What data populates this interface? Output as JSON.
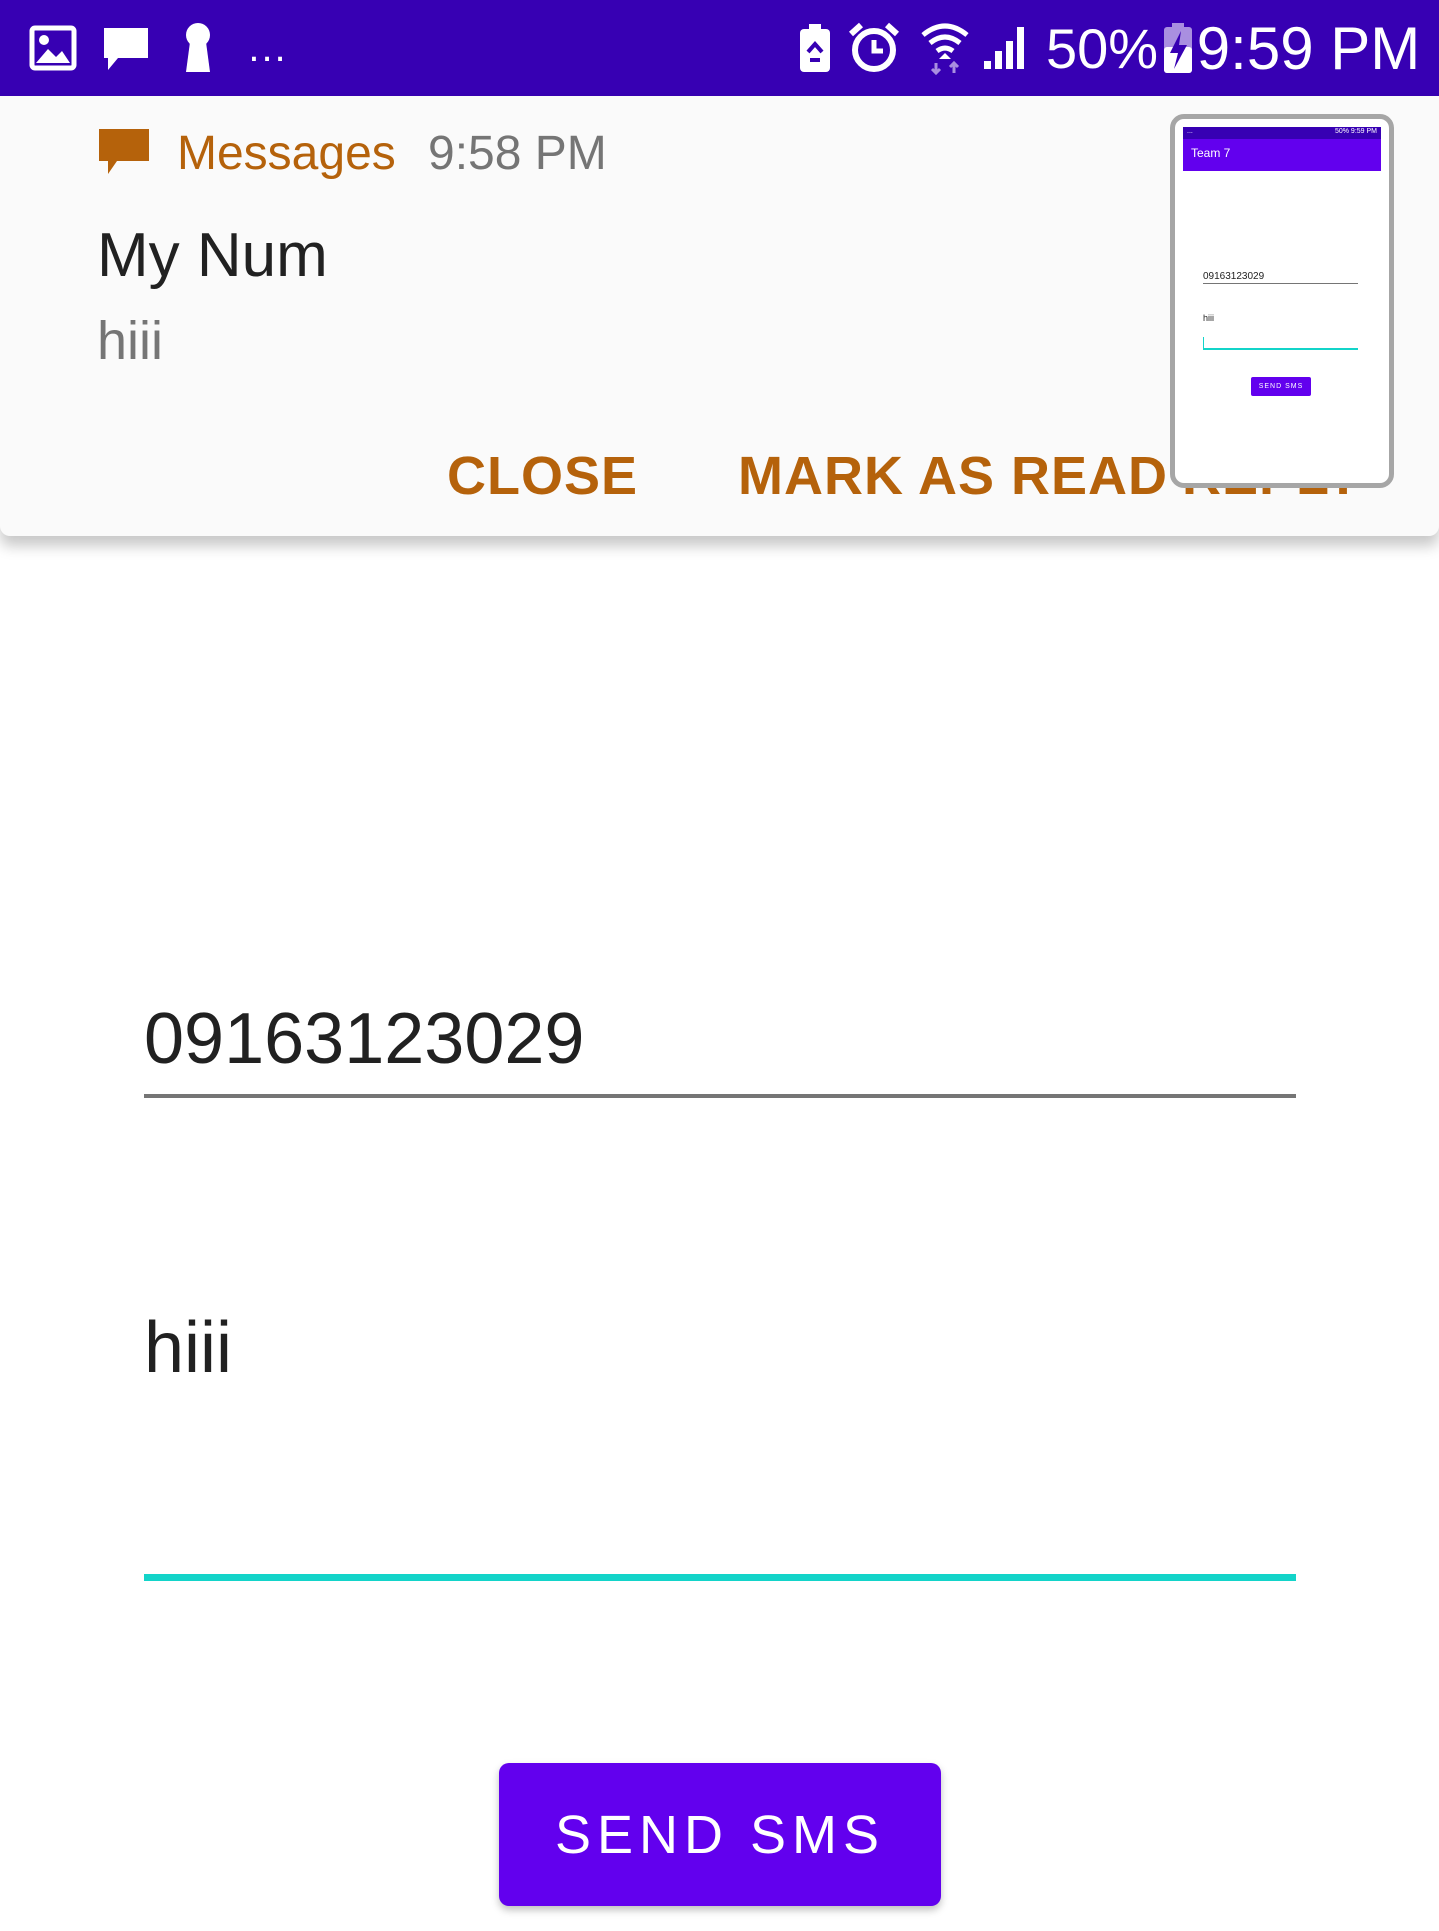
{
  "status_bar": {
    "left_icons": [
      "image-icon",
      "chat-bubble-icon",
      "keyhole-icon"
    ],
    "overflow": "...",
    "right_icons": [
      "battery-saver-icon",
      "alarm-clock-icon",
      "wifi-icon",
      "cell-signal-icon",
      "charging-battery-icon"
    ],
    "battery_percent": "50%",
    "time": "9:59 PM",
    "background": "#3700b3"
  },
  "notification": {
    "app_icon": "message-bubble-icon",
    "app_name": "Messages",
    "time": "9:58 PM",
    "title": "My Num",
    "body": "hiii",
    "actions": {
      "close": "CLOSE",
      "mark_as_read": "MARK AS READ",
      "reply": "REPLY"
    },
    "accent": "#b5620b"
  },
  "thumbnail": {
    "status_text_left": "...",
    "status_text_right": "50% 9:59 PM",
    "app_title": "Team 7",
    "number": "09163123029",
    "message": "hiii",
    "button": "SEND SMS"
  },
  "form": {
    "phone_value": "09163123029",
    "message_value": "hiii",
    "focused_underline_color": "#13d4c9"
  },
  "send_button": {
    "label": "SEND SMS",
    "color": "#6200ee"
  }
}
